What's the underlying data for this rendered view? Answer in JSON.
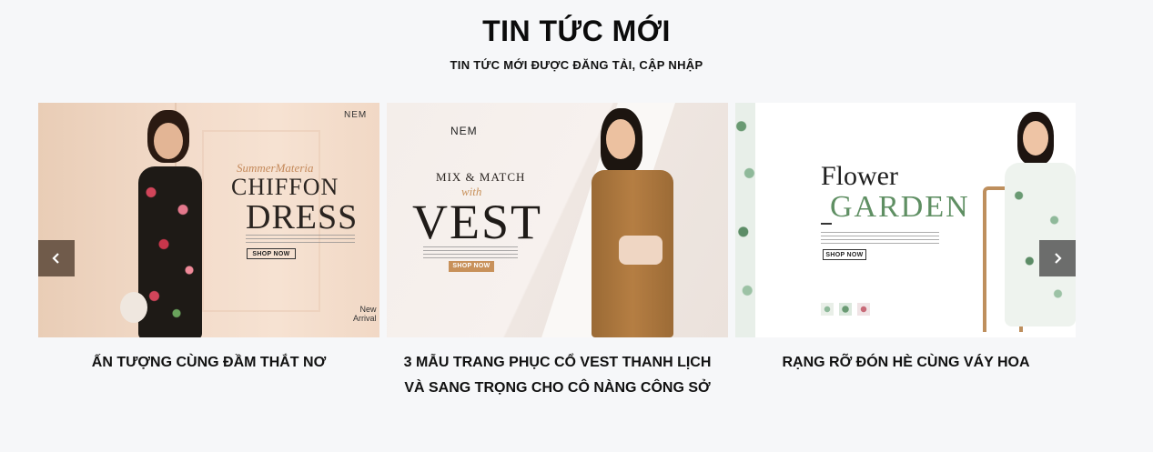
{
  "section": {
    "title": "TIN TỨC MỚI",
    "subtitle": "TIN TỨC MỚI ĐƯỢC ĐĂNG TẢI, CẬP NHẬP"
  },
  "cards": [
    {
      "title": "ẤN TƯỢNG CÙNG ĐẦM THẮT NƠ",
      "banner": {
        "brand": "NEM",
        "script": "SummerMateria",
        "line1": "CHIFFON",
        "line2": "DRESS",
        "cta": "SHOP NOW",
        "badge_new": "New",
        "badge_arrival": "Arrival"
      }
    },
    {
      "title": "3 MẪU TRANG PHỤC CỔ VEST THANH LỊCH VÀ SANG TRỌNG CHO CÔ NÀNG CÔNG SỞ",
      "banner": {
        "brand": "NEM",
        "line1": "MIX & MATCH",
        "script": "with",
        "line2": "VEST",
        "cta": "SHOP NOW"
      }
    },
    {
      "title": "RẠNG RỠ ĐÓN HÈ CÙNG VÁY HOA",
      "banner": {
        "line1": "Flower",
        "line2": "GARDEN",
        "cta": "SHOP NOW"
      }
    }
  ],
  "colors": {
    "page_bg": "#f6f7f9",
    "arrow_left_bg": "#5a4637",
    "arrow_right_bg": "#555555",
    "vest_cta": "#c8915a"
  },
  "icons": {
    "prev": "chevron-left-icon",
    "next": "chevron-right-icon"
  }
}
